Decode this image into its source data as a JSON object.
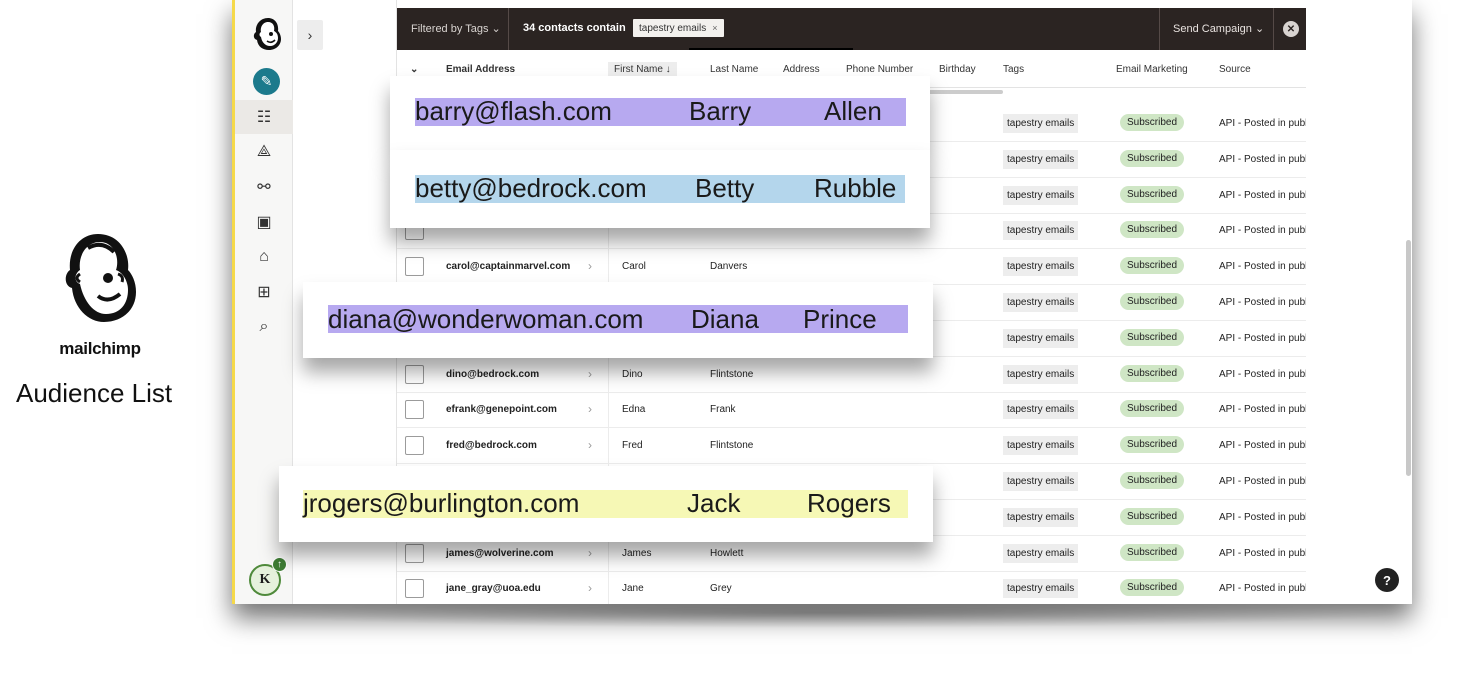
{
  "branding": {
    "name": "mailchimp",
    "caption": "Audience List"
  },
  "topbar": {
    "filter_label": "Filtered by Tags ⌄",
    "count_label": "34 contacts contain",
    "tag_chip": "tapestry emails",
    "tag_remove": "×",
    "send_campaign": "Send Campaign ⌄",
    "close_icon": "close-circle-icon"
  },
  "table": {
    "headers": {
      "toggle": "⌄",
      "email": "Email Address",
      "first_name": "First Name ↓",
      "last_name": "Last Name",
      "address": "Address",
      "phone": "Phone Number",
      "birthday": "Birthday",
      "tags": "Tags",
      "email_marketing": "Email Marketing",
      "source": "Source"
    },
    "rows": [
      {
        "email": "",
        "first": "",
        "last": "",
        "tag": "tapestry emails",
        "status": "Subscribed",
        "source": "API - Posted in publ"
      },
      {
        "email": "",
        "first": "",
        "last": "",
        "tag": "tapestry emails",
        "status": "Subscribed",
        "source": "API - Posted in publ"
      },
      {
        "email": "",
        "first": "",
        "last": "",
        "tag": "tapestry emails",
        "status": "Subscribed",
        "source": "API - Posted in publ"
      },
      {
        "email": "",
        "first": "",
        "last": "",
        "tag": "tapestry emails",
        "status": "Subscribed",
        "source": "API - Posted in publ"
      },
      {
        "email": "carol@captainmarvel.com",
        "first": "Carol",
        "last": "Danvers",
        "tag": "tapestry emails",
        "status": "Subscribed",
        "source": "API - Posted in publ"
      },
      {
        "email": "",
        "first": "",
        "last": "",
        "tag": "tapestry emails",
        "status": "Subscribed",
        "source": "API - Posted in publ"
      },
      {
        "email": "",
        "first": "",
        "last": "",
        "tag": "tapestry emails",
        "status": "Subscribed",
        "source": "API - Posted in publ"
      },
      {
        "email": "dino@bedrock.com",
        "first": "Dino",
        "last": "Flintstone",
        "tag": "tapestry emails",
        "status": "Subscribed",
        "source": "API - Posted in publ"
      },
      {
        "email": "efrank@genepoint.com",
        "first": "Edna",
        "last": "Frank",
        "tag": "tapestry emails",
        "status": "Subscribed",
        "source": "API - Posted in publ"
      },
      {
        "email": "fred@bedrock.com",
        "first": "Fred",
        "last": "Flintstone",
        "tag": "tapestry emails",
        "status": "Subscribed",
        "source": "API - Posted in publ"
      },
      {
        "email": "",
        "first": "",
        "last": "",
        "tag": "tapestry emails",
        "status": "Subscribed",
        "source": "API - Posted in publ"
      },
      {
        "email": "",
        "first": "",
        "last": "",
        "tag": "tapestry emails",
        "status": "Subscribed",
        "source": "API - Posted in publ"
      },
      {
        "email": "james@wolverine.com",
        "first": "James",
        "last": "Howlett",
        "tag": "tapestry emails",
        "status": "Subscribed",
        "source": "API - Posted in publ"
      },
      {
        "email": "jane_gray@uoa.edu",
        "first": "Jane",
        "last": "Grey",
        "tag": "tapestry emails",
        "status": "Subscribed",
        "source": "API - Posted in publ"
      }
    ]
  },
  "callouts": [
    {
      "email": "barry@flash.com",
      "first": "Barry",
      "last": "Allen",
      "highlight": "#b7a9f0"
    },
    {
      "email": "betty@bedrock.com",
      "first": "Betty",
      "last": "Rubble",
      "highlight": "#b4d6ec"
    },
    {
      "email": "diana@wonderwoman.com",
      "first": "Diana",
      "last": "Prince",
      "highlight": "#b7a9f0"
    },
    {
      "email": "jrogers@burlington.com",
      "first": "Jack",
      "last": "Rogers",
      "highlight": "#f6f8b5"
    }
  ],
  "sidebar": {
    "avatar_initial": "K",
    "avatar_badge": "↑",
    "panel_toggle": "›",
    "help": "?"
  },
  "colors": {
    "accent": "#f5d94a",
    "topbar": "#2b2422",
    "subscribed": "#cfe6c5",
    "brand_teal": "#1c7a8c"
  }
}
